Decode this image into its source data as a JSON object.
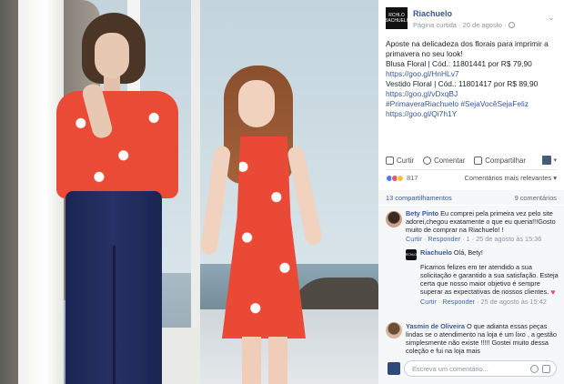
{
  "page": {
    "name": "Riachuelo",
    "logo_text": "RCHLO RIACHUELO",
    "meta_prefix": "Página curtida · 20 de agosto ·"
  },
  "post": {
    "lines": [
      "Aposte na delicadeza dos florais para imprimir a",
      "primavera no seu look!",
      "Blusa Floral | Cód.: 11801441 por R$ 79,90"
    ],
    "link1": "https://goo.gl/HnHLv7",
    "line4": "Vestido Floral | Cód.: 11801417 por R$ 89,90",
    "link2": "https://goo.gl/vDxqBJ",
    "hashtags": "#PrimaveraRiachuelo #SejaVocêSejaFeliz",
    "link3": "https://goo.gl/Qi7h1Y"
  },
  "actions": {
    "like": "Curtir",
    "comment": "Comentar",
    "share": "Compartilhar"
  },
  "reactions": {
    "count": "817",
    "sort_label": "Comentários mais relevantes ▾"
  },
  "counts": {
    "shares": "13 compartilhamentos",
    "comments": "9 comentários"
  },
  "comments": [
    {
      "author": "Bety Pinto",
      "text": "Eu comprei pela primeira vez pelo site adorei,chegou exatamente o que eu queria!!!Gosto muito de comprar na Riachuelo! !",
      "like": "Curtir",
      "reply": "Responder",
      "time": "· 1 · 25 de agosto às 15:36"
    },
    {
      "author": "Riachuelo",
      "text_head": "Olá, Bety!",
      "text_body": "Ficamos felizes em ter atendido a sua solicitação e garantido a sua satisfação. Esteja certa que nosso maior objetivo é sempre superar as expectativas de nossos clientes.",
      "like": "Curtir",
      "reply": "Responder",
      "time": "· 25 de agosto às 15:42"
    },
    {
      "author": "Yasmin de Oliveira",
      "text": "O que adianta essas peças lindas se o atendimento na loja é um lixo , a gestão simplesmente não existe !!!!! Gostei muito dessa coleção e fui na loja mais"
    }
  ],
  "compose": {
    "placeholder": "Escreva um comentário..."
  }
}
